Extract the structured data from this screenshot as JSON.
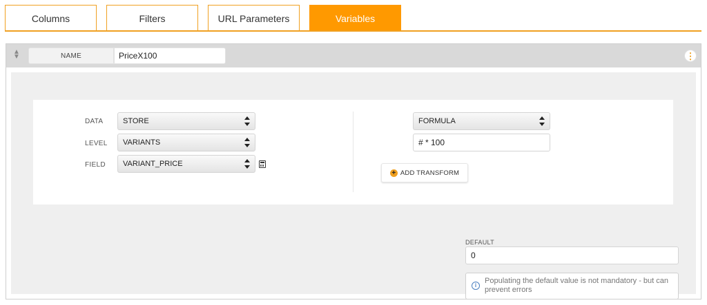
{
  "tabs": [
    {
      "label": "Columns",
      "active": false
    },
    {
      "label": "Filters",
      "active": false
    },
    {
      "label": "URL Parameters",
      "active": false
    },
    {
      "label": "Variables",
      "active": true
    }
  ],
  "variable": {
    "name_label": "NAME",
    "name_value": "PriceX100"
  },
  "source": {
    "data_label": "DATA",
    "data_value": "STORE",
    "level_label": "LEVEL",
    "level_value": "VARIANTS",
    "field_label": "FIELD",
    "field_value": "VARIANT_PRICE"
  },
  "transform": {
    "type_value": "FORMULA",
    "formula_value": "# * 100",
    "add_label": "ADD TRANSFORM"
  },
  "default": {
    "label": "DEFAULT",
    "value": "0",
    "info_text": "Populating the default value is not mandatory - but can prevent errors"
  },
  "colors": {
    "accent": "#ff9900",
    "info": "#4a7fc0"
  },
  "icons": [
    "drag-handle-icon",
    "more-options-icon",
    "calculator-icon",
    "plus-circle-icon",
    "info-icon",
    "select-caret-icon"
  ]
}
